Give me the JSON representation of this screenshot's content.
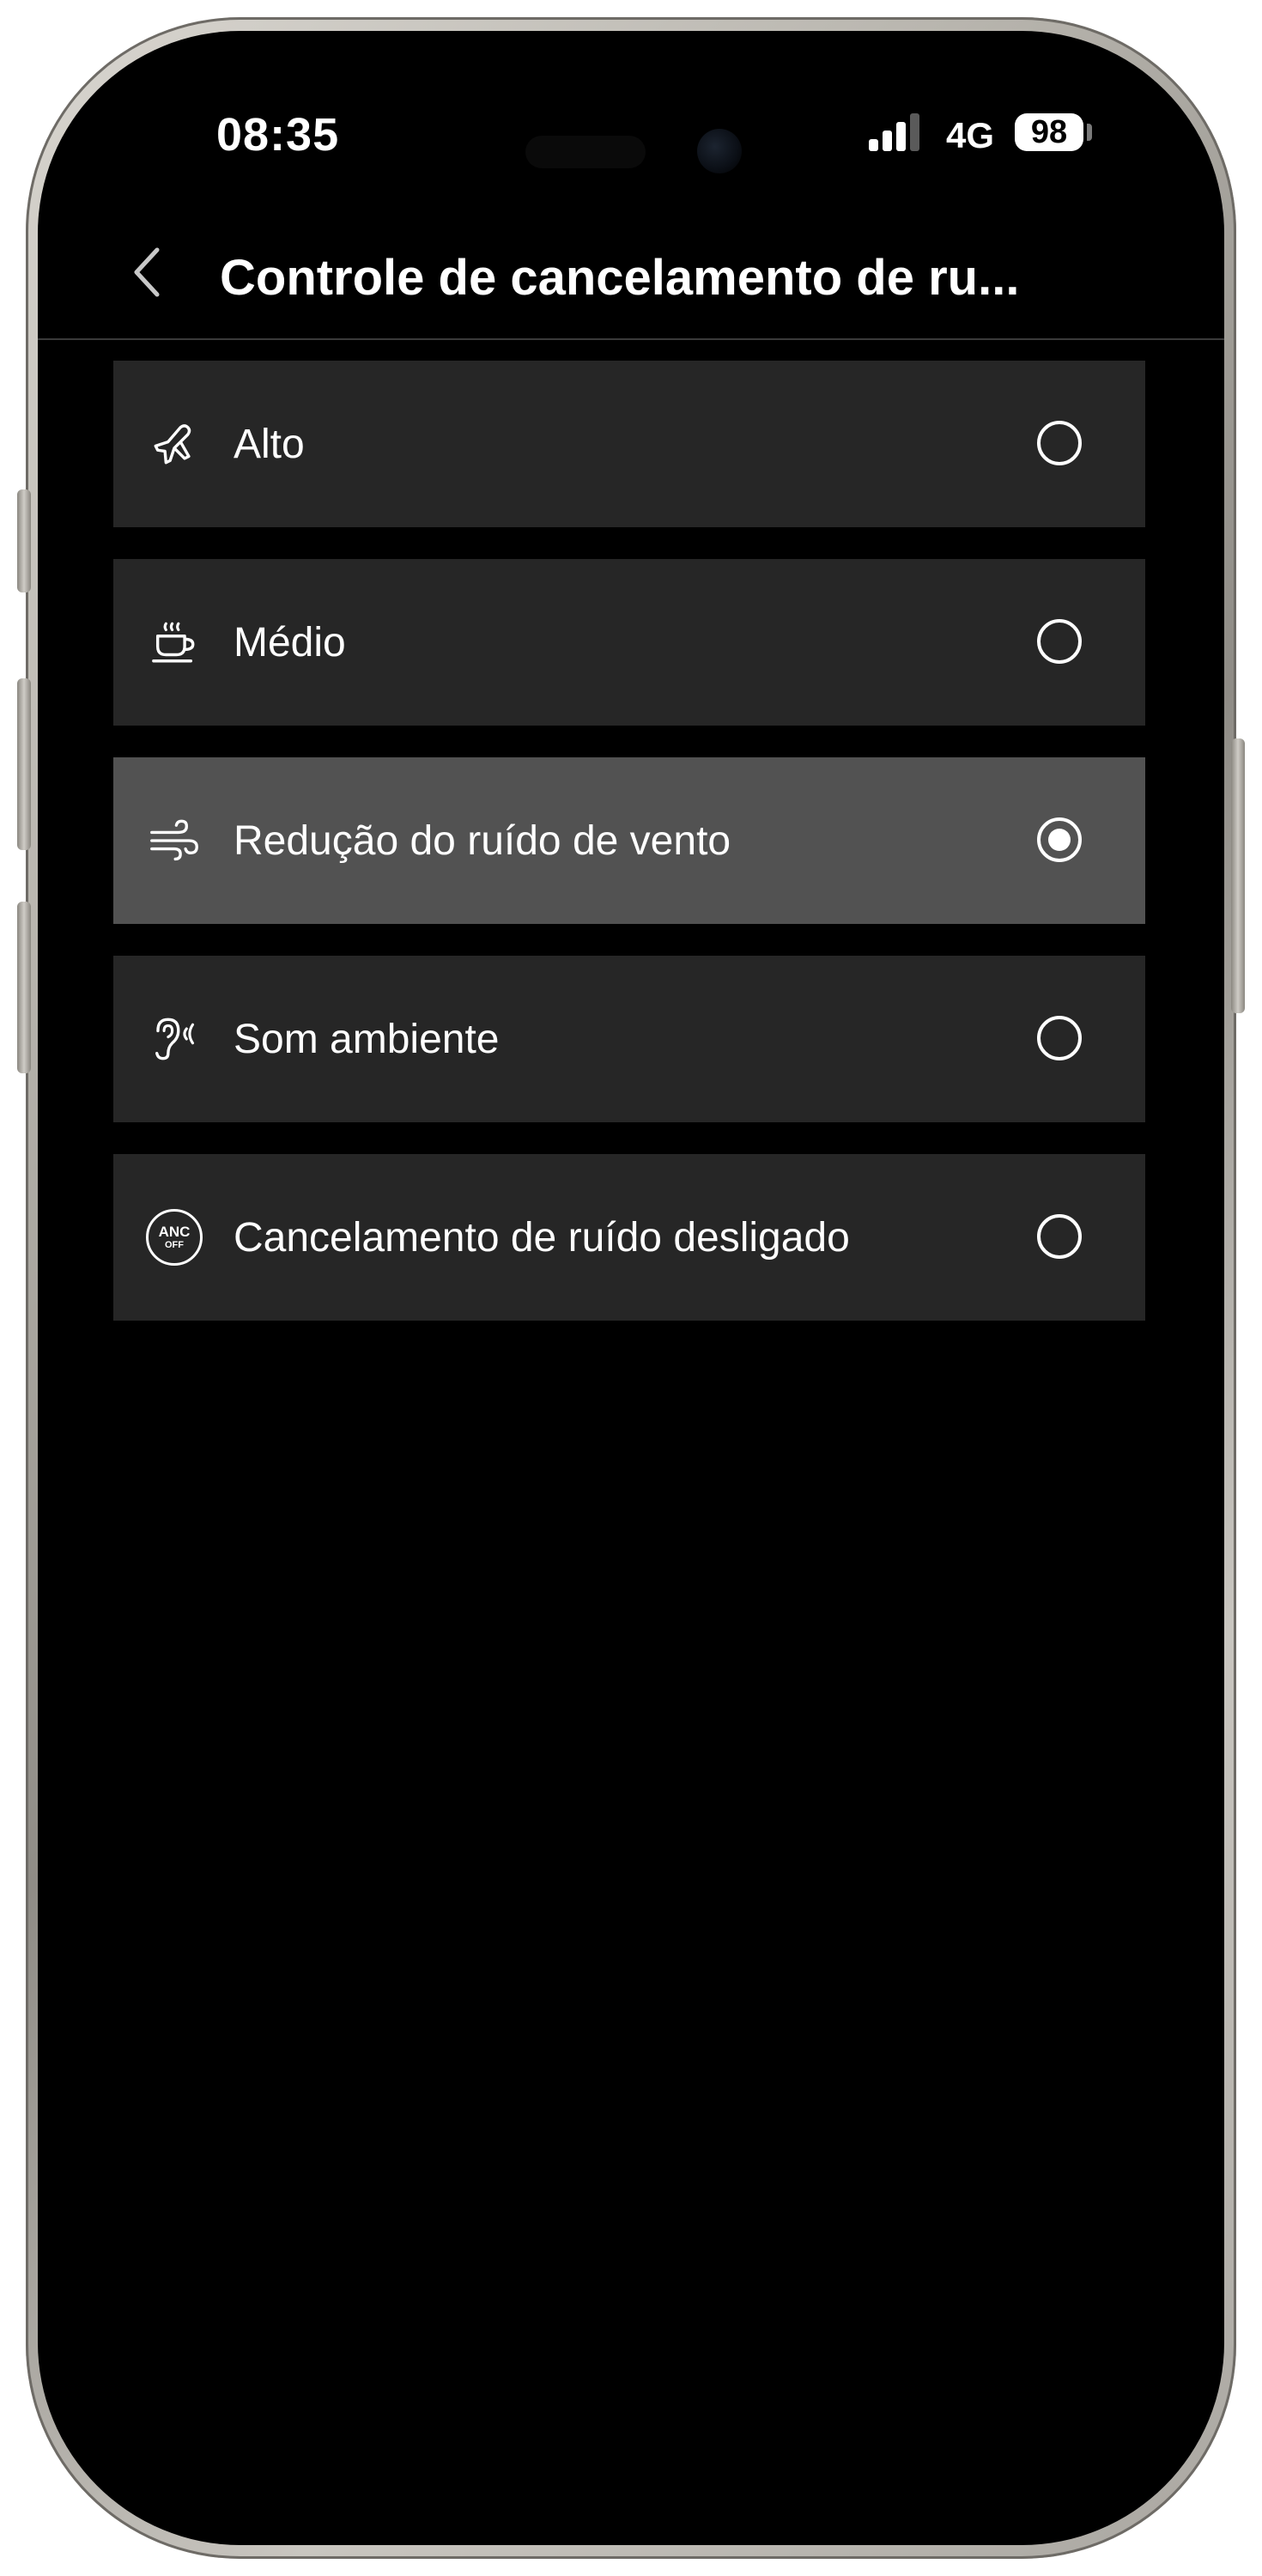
{
  "status_bar": {
    "time": "08:35",
    "network": "4G",
    "battery": "98"
  },
  "header": {
    "title": "Controle de cancelamento de ru..."
  },
  "options": [
    {
      "label": "Alto",
      "icon": "airplane-icon",
      "selected": false
    },
    {
      "label": "Médio",
      "icon": "coffee-cup-icon",
      "selected": false
    },
    {
      "label": "Redução do ruído de vento",
      "icon": "wind-icon",
      "selected": true
    },
    {
      "label": "Som ambiente",
      "icon": "ear-icon",
      "selected": false
    },
    {
      "label": "Cancelamento de ruído desligado",
      "icon": "anc-off-icon",
      "selected": false,
      "badge_top": "ANC",
      "badge_bottom": "OFF"
    }
  ],
  "colors": {
    "background": "#000000",
    "row": "#262626",
    "row_selected": "#525252",
    "text": "#ffffff"
  }
}
